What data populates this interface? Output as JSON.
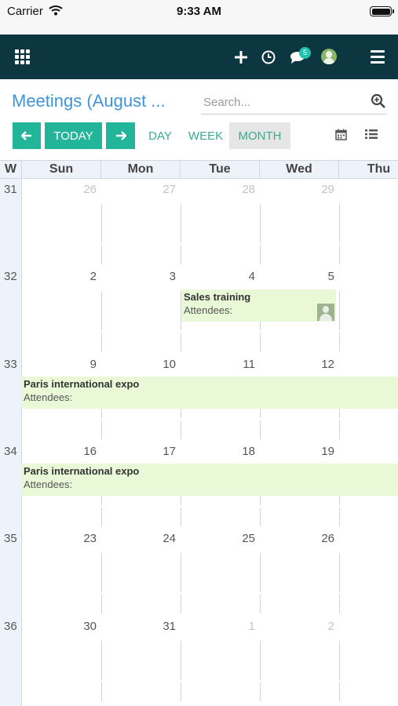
{
  "status_bar": {
    "carrier": "Carrier",
    "time": "9:33 AM"
  },
  "navbar": {
    "notification_count": "5"
  },
  "header": {
    "title": "Meetings (August ...",
    "search_placeholder": "Search..."
  },
  "toolbar": {
    "today_label": "TODAY",
    "day_label": "DAY",
    "week_label": "WEEK",
    "month_label": "MONTH",
    "active_view": "MONTH"
  },
  "calendar": {
    "week_header": "W",
    "day_headers": [
      "Sun",
      "Mon",
      "Tue",
      "Wed",
      "Thu"
    ],
    "weeks": [
      {
        "week": "31",
        "days": [
          {
            "n": "26",
            "muted": true
          },
          {
            "n": "27",
            "muted": true
          },
          {
            "n": "28",
            "muted": true
          },
          {
            "n": "29",
            "muted": true
          }
        ]
      },
      {
        "week": "32",
        "days": [
          {
            "n": "2",
            "muted": false
          },
          {
            "n": "3",
            "muted": false
          },
          {
            "n": "4",
            "muted": false
          },
          {
            "n": "5",
            "muted": false
          }
        ]
      },
      {
        "week": "33",
        "days": [
          {
            "n": "9",
            "muted": false
          },
          {
            "n": "10",
            "muted": false
          },
          {
            "n": "11",
            "muted": false
          },
          {
            "n": "12",
            "muted": false
          }
        ]
      },
      {
        "week": "34",
        "days": [
          {
            "n": "16",
            "muted": false
          },
          {
            "n": "17",
            "muted": false
          },
          {
            "n": "18",
            "muted": false
          },
          {
            "n": "19",
            "muted": false
          }
        ]
      },
      {
        "week": "35",
        "days": [
          {
            "n": "23",
            "muted": false
          },
          {
            "n": "24",
            "muted": false
          },
          {
            "n": "25",
            "muted": false
          },
          {
            "n": "26",
            "muted": false
          }
        ]
      },
      {
        "week": "36",
        "days": [
          {
            "n": "30",
            "muted": false
          },
          {
            "n": "31",
            "muted": false
          },
          {
            "n": "1",
            "muted": true
          },
          {
            "n": "2",
            "muted": true
          }
        ]
      }
    ],
    "events": [
      {
        "name": "Sales training",
        "attendees": "Attendees:",
        "has_avatar": true
      },
      {
        "name": "Paris international expo",
        "attendees": "Attendees:",
        "has_avatar": false
      },
      {
        "name": "Paris international expo",
        "attendees": "Attendees:",
        "has_avatar": false
      }
    ]
  },
  "colors": {
    "navbar": "#0c3640",
    "accent": "#22b59a",
    "title": "#3f94d9",
    "event_bg": "#e9f9d8"
  }
}
